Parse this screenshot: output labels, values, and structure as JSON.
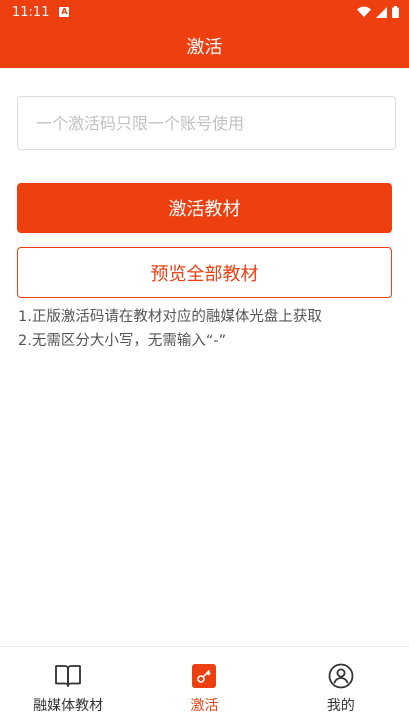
{
  "status_bar": {
    "time": "11:11",
    "notification_icon": "a-badge-icon",
    "icons": [
      "wifi-icon",
      "signal-icon",
      "battery-icon"
    ]
  },
  "title_bar": {
    "title": "激活"
  },
  "activation": {
    "code_placeholder": "一个激活码只限一个账号使用",
    "code_value": "",
    "activate_label": "激活教材",
    "preview_label": "预览全部教材"
  },
  "notes": [
    "1.正版激活码请在教材对应的融媒体光盘上获取",
    "2.无需区分大小写，无需输入“-”"
  ],
  "bottom_nav": {
    "items": [
      {
        "label": "融媒体教材",
        "icon": "book-icon",
        "active": false
      },
      {
        "label": "激活",
        "icon": "key-icon",
        "active": true
      },
      {
        "label": "我的",
        "icon": "user-icon",
        "active": false
      }
    ]
  },
  "colors": {
    "brand": "#EE3F11",
    "text": "#333333",
    "muted": "#555555",
    "placeholder": "#C0C0C0"
  }
}
